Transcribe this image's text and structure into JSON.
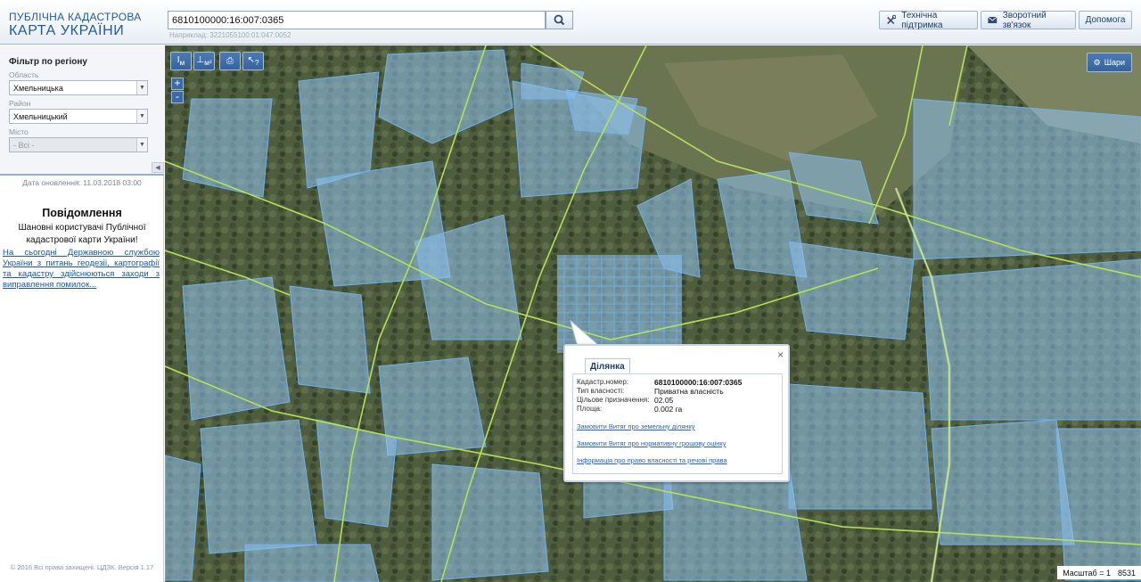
{
  "header": {
    "logo_line1": "ПУБЛІЧНА КАДАСТРОВА",
    "logo_line2": "КАРТА УКРАЇНИ",
    "search_value": "6810100000:16:007:0365",
    "search_hint": "Наприклад: 3221055100:01:047:0052",
    "support_label": "Технічна підтримка",
    "feedback_label": "Зворотний зв'язок",
    "help_label": "Допомога"
  },
  "sidebar": {
    "filter_title": "Фільтр по регіону",
    "region_label": "Область",
    "region_value": "Хмельницька",
    "district_label": "Район",
    "district_value": "Хмельницький",
    "city_label": "Місто",
    "city_value": "- Всі -",
    "update_date": "Дата оновлення: 11.03.2018 03:00",
    "notice_title": "Повідомлення",
    "notice_text": "Шановні користувачі Публічної кадастрової карти України!",
    "notice_link": "На сьогодні Державною службою України з питань геодезії, картографії та кадастру здійснюються заходи з виправлення помилок...",
    "copyright": "© 2016 Всі права захищені. ЦДЗК. Версія 1.17"
  },
  "map": {
    "layers_label": "Шари",
    "zoom_in": "+",
    "zoom_out": "-",
    "scale_label": "Масштаб = 1",
    "scale_value": "8531",
    "tool_measure": "м",
    "tool_area": "м²",
    "tool_help": "?"
  },
  "popup": {
    "tab_label": "Ділянка",
    "rows": [
      {
        "label": "Кадастр.номер:",
        "value": "6810100000:16:007:0365"
      },
      {
        "label": "Тип власності:",
        "value": "Приватна власність"
      },
      {
        "label": "Цільове призначення:",
        "value": "02.05"
      },
      {
        "label": "Площа:",
        "value": "0.002 га"
      }
    ],
    "link1": "Замовити Витяг про земельну ділянку",
    "link2": "Замовити Витяг про нормативну грошову оцінку",
    "link3": "Інформація про право власності та речові права",
    "close_symbol": "×"
  },
  "colors": {
    "parcel_fill": "#8fc2f0",
    "parcel_stroke": "#6fb1ee",
    "road_line": "#b5e05a",
    "header_text": "#1f5b9e",
    "link": "#1a56c4"
  }
}
